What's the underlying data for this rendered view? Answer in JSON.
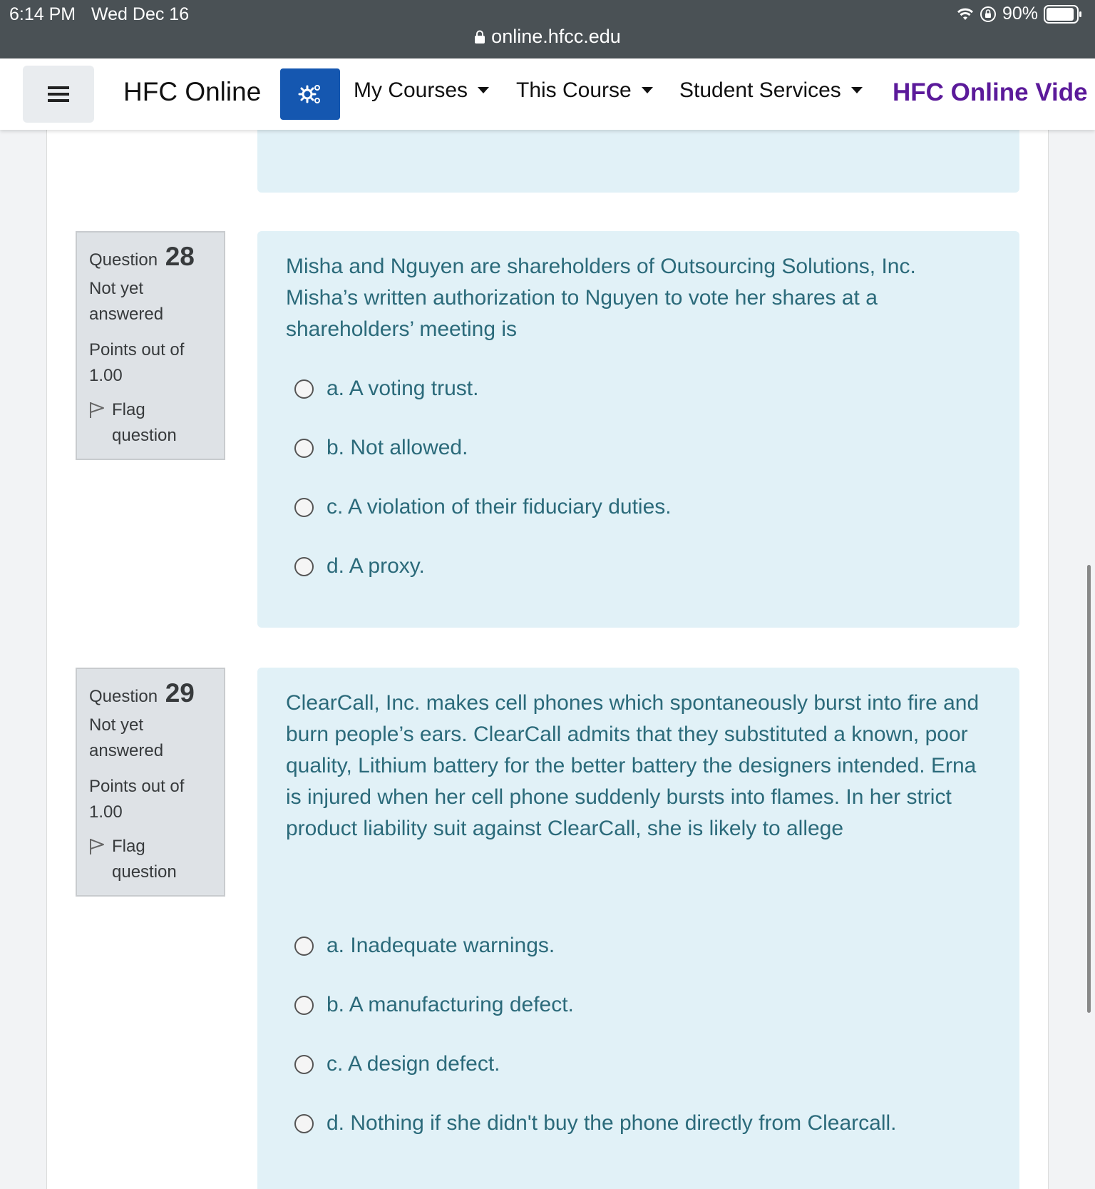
{
  "status_bar": {
    "time": "6:14 PM",
    "date": "Wed Dec 16",
    "battery": "90%",
    "url": "online.hfcc.edu"
  },
  "navbar": {
    "brand": "HFC Online",
    "menu_items": [
      "My Courses",
      "This Course",
      "Student Services"
    ],
    "video_link": "HFC Online Vide",
    "accent_color": "#1557b0",
    "video_color": "#5b1a9a"
  },
  "questions": [
    {
      "label": "Question",
      "number": "28",
      "state": "Not yet answered",
      "grade": "Points out of 1.00",
      "flag": "Flag question",
      "text": "Misha and Nguyen are shareholders of Outsourcing Solutions, Inc. Misha’s written authorization to Nguyen to vote her shares at a shareholders’ meeting is",
      "answers": [
        "a. A voting trust.",
        "b. Not allowed.",
        "c. A violation of their fiduciary duties.",
        "d. A proxy."
      ]
    },
    {
      "label": "Question",
      "number": "29",
      "state": "Not yet answered",
      "grade": "Points out of 1.00",
      "flag": "Flag question",
      "text": "ClearCall, Inc. makes cell phones which spontaneously burst into fire and burn people’s ears. ClearCall admits that they substituted a known, poor quality, Lithium battery for the better battery the designers intended. Erna is injured when her cell phone suddenly bursts into flames. In her strict product liability suit against ClearCall, she is likely to allege",
      "answers": [
        "a. Inadequate warnings.",
        "b. A manufacturing defect.",
        "c. A design defect.",
        "d. Nothing if she didn't buy the phone directly from Clearcall."
      ]
    }
  ]
}
